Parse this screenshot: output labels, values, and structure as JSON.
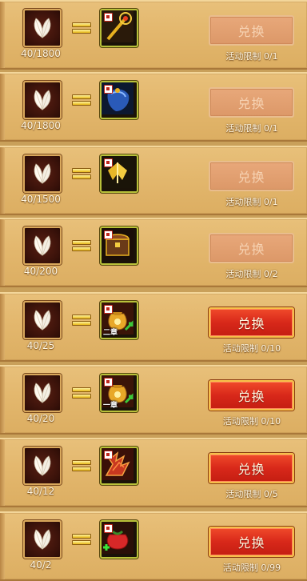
{
  "rows": [
    {
      "cost": "40/1800",
      "item_icon": "golden-staff-icon",
      "button_label": "兑换",
      "button_state": "disabled",
      "limit": "活动限制 0/1"
    },
    {
      "cost": "40/1800",
      "item_icon": "blue-cape-icon",
      "button_label": "兑换",
      "button_state": "disabled",
      "limit": "活动限制 0/1"
    },
    {
      "cost": "40/1500",
      "item_icon": "golden-wings-icon",
      "button_label": "兑换",
      "button_state": "disabled",
      "limit": "活动限制 0/1"
    },
    {
      "cost": "40/200",
      "item_icon": "treasure-chest-icon",
      "button_label": "兑换",
      "button_state": "disabled",
      "limit": "活动限制 0/2"
    },
    {
      "cost": "40/25",
      "item_icon": "money-bag-icon",
      "item_text": "二章",
      "button_label": "兑换",
      "button_state": "active",
      "limit": "活动限制 0/10"
    },
    {
      "cost": "40/20",
      "item_icon": "money-bag-icon",
      "item_text": "一章",
      "button_label": "兑换",
      "button_state": "active",
      "limit": "活动限制 0/10"
    },
    {
      "cost": "40/12",
      "item_icon": "red-rune-fragment-icon",
      "button_label": "兑换",
      "button_state": "active",
      "limit": "活动限制 0/5"
    },
    {
      "cost": "40/2",
      "item_icon": "red-potion-bag-icon",
      "button_label": "兑换",
      "button_state": "active",
      "limit": "活动限制 0/99"
    }
  ],
  "currency_icon": "white-leaf-icon",
  "colors": {
    "panel": "#e3b76d",
    "button_active": "#d8281a",
    "button_disabled": "#e3a070",
    "item_border": "#b8c13a"
  }
}
